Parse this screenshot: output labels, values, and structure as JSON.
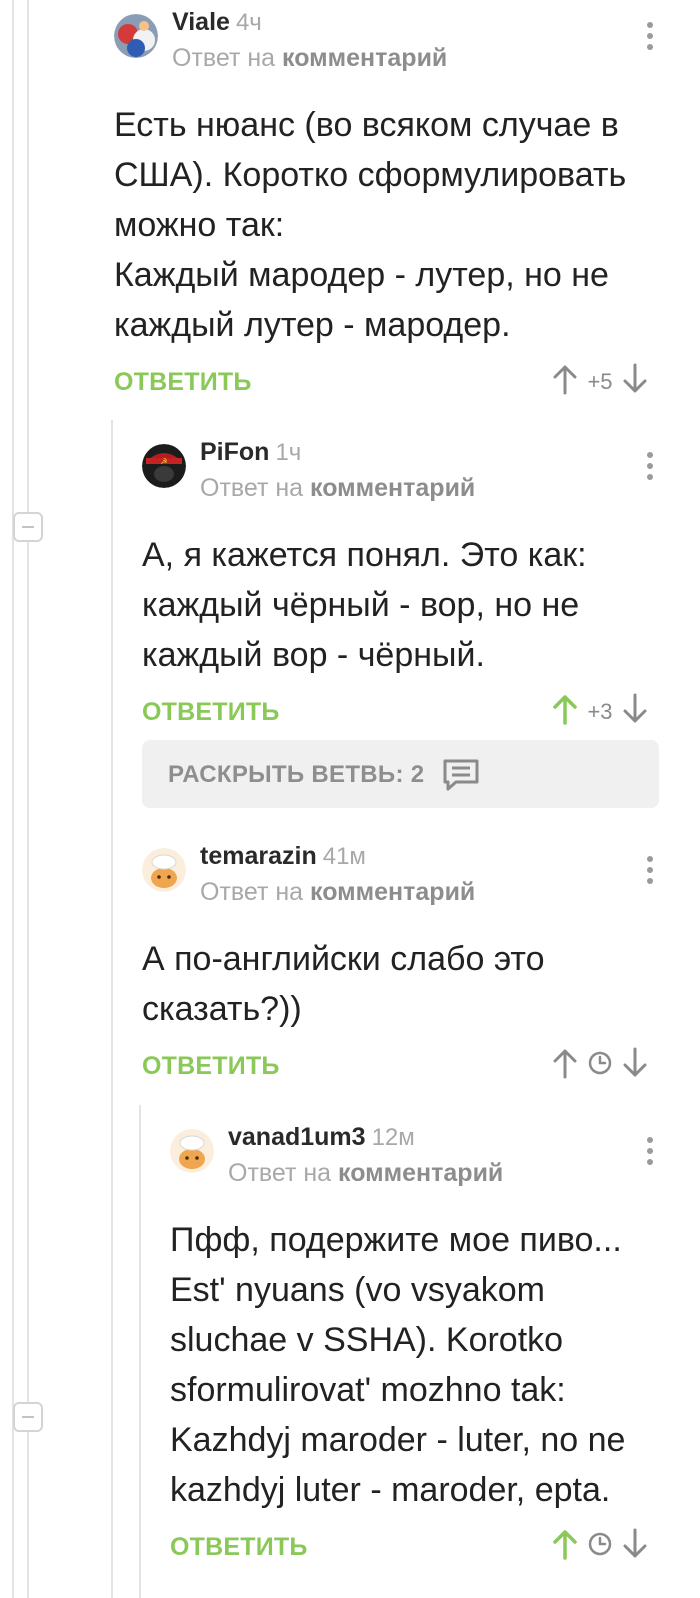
{
  "comments": [
    {
      "author": "Viale",
      "time": "4ч",
      "reply_prefix": "Ответ на",
      "reply_link": "комментарий",
      "lines": [
        "Есть нюанс (во всяком случае в",
        "США). Коротко сформулировать",
        "можно так:",
        "Каждый мародер - лутер, но не",
        "каждый лутер - мародер."
      ],
      "reply_label": "ОТВЕТИТЬ",
      "rating": "+5",
      "upvoted": false
    },
    {
      "author": "PiFon",
      "time": "1ч",
      "reply_prefix": "Ответ на",
      "reply_link": "комментарий",
      "lines": [
        "А, я кажется понял. Это как:",
        "каждый чёрный - вор, но не",
        "каждый вор - чёрный."
      ],
      "reply_label": "ОТВЕТИТЬ",
      "rating": "+3",
      "upvoted": true
    },
    {
      "author": "temarazin",
      "time": "41м",
      "reply_prefix": "Ответ на",
      "reply_link": "комментарий",
      "lines": [
        "А по-английски слабо это",
        "сказать?))"
      ],
      "reply_label": "ОТВЕТИТЬ",
      "upvoted": false
    },
    {
      "author": "vanad1um3",
      "time": "12м",
      "reply_prefix": "Ответ на",
      "reply_link": "комментарий",
      "lines": [
        "Пфф, подержите мое пиво...",
        "Est' nyuans (vo vsyakom",
        "sluchae v SSHA). Korotko",
        "sformulirovat' mozhno tak:",
        "Kazhdyj maroder - luter, no ne",
        "kazhdyj luter - maroder, epta."
      ],
      "reply_label": "ОТВЕТИТЬ",
      "upvoted": true
    }
  ],
  "expand_branch": {
    "label": "РАСКРЫТЬ ВЕТВЬ: 2"
  },
  "icons": {
    "menu": "more-vertical-icon",
    "collapse": "minus-square-icon",
    "upvote": "arrow-up-icon",
    "downvote": "arrow-down-icon",
    "pending": "clock-icon",
    "thread": "comments-icon"
  },
  "colors": {
    "accent_green": "#8ac858",
    "muted_text": "#a8a8a8",
    "thread_line": "#e4e4e4",
    "expand_bg": "#f0f0f0"
  }
}
